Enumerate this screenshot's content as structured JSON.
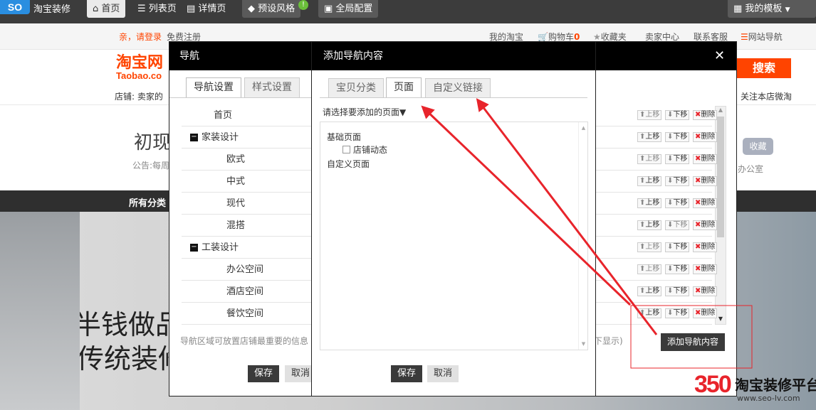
{
  "topbar": {
    "logo": "SO",
    "title": "淘宝装修",
    "tabs": [
      "首页",
      "列表页",
      "详情页"
    ],
    "preset_style": "预设风格",
    "preset_badge": "!",
    "global_config": "全局配置",
    "my_templates": "我的模板"
  },
  "minibar": {
    "login": "亲，请登录",
    "register": "免费注册",
    "my_taobao": "我的淘宝",
    "cart": "购物车",
    "cart_count": "0",
    "favorites": "收藏夹",
    "seller_center": "卖家中心",
    "support": "联系客服",
    "site_nav": "网站导航"
  },
  "shophead": {
    "logo_cn": "淘宝网",
    "logo_en": "Taobao.co",
    "search_btn": "搜索",
    "shop_label": "店铺:",
    "shop_name": "卖家的",
    "follow": "关注本店微淘"
  },
  "storebody": {
    "store_title": "初现",
    "notice": "公告:每周",
    "collect": "收藏",
    "side_text": "办公室",
    "category_bar": "所有分类",
    "banner_line1": "花一半钱做品",
    "banner_line2": "联网与传统装修"
  },
  "nav_dialog": {
    "title": "导航",
    "tabs": [
      "导航设置",
      "样式设置"
    ],
    "rows": [
      {
        "label": "首页",
        "level": 0
      },
      {
        "label": "家装设计",
        "level": 1
      },
      {
        "label": "欧式",
        "level": 2
      },
      {
        "label": "中式",
        "level": 2
      },
      {
        "label": "现代",
        "level": 2
      },
      {
        "label": "混搭",
        "level": 2
      },
      {
        "label": "工装设计",
        "level": 1
      },
      {
        "label": "办公空间",
        "level": 2
      },
      {
        "label": "酒店空间",
        "level": 2
      },
      {
        "label": "餐饮空间",
        "level": 2
      }
    ],
    "row_actions": {
      "up": "上移",
      "down": "下移",
      "delete": "删除"
    },
    "hint": "导航区域可放置店铺最重要的信息",
    "hint_tail": "下显示)",
    "add_button": "添加导航内容",
    "save": "保存",
    "cancel": "取消",
    "close": "✕"
  },
  "add_dialog": {
    "title": "添加导航内容",
    "tabs": [
      "宝贝分类",
      "页面",
      "自定义链接"
    ],
    "active_tab": "页面",
    "select_label": "请选择要添加的页面▼",
    "groups": [
      {
        "label": "基础页面",
        "items": [
          "店铺动态"
        ]
      },
      {
        "label": "自定义页面",
        "items": []
      }
    ],
    "save": "保存",
    "cancel": "取消"
  },
  "watermark": {
    "brand_num": "350",
    "brand_text": "淘宝装修平台",
    "url": "www.seo-lv.com"
  },
  "colors": {
    "accent": "#ff4400",
    "arrow": "#e8242b",
    "dialog_title": "#000000"
  }
}
